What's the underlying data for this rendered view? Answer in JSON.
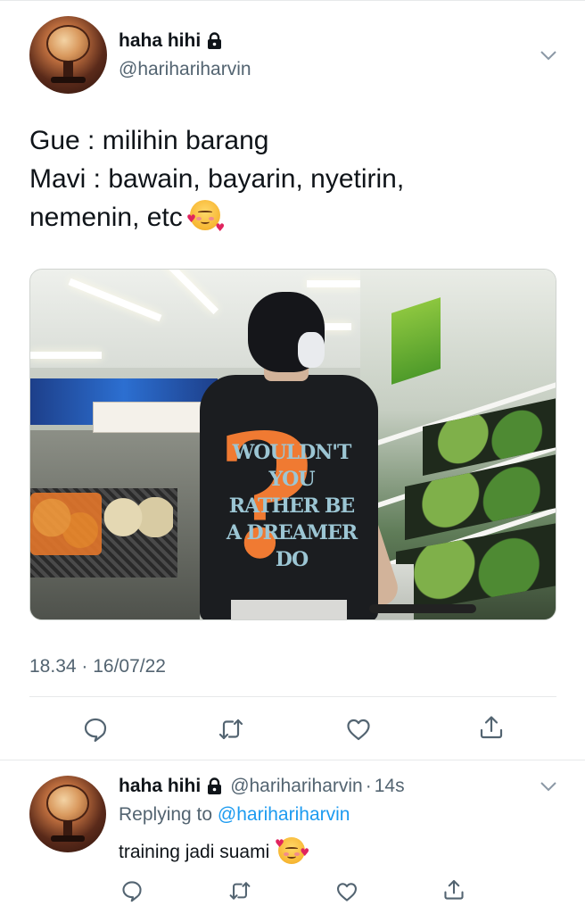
{
  "tweet": {
    "display_name": "haha hihi",
    "handle": "@harihariharvin",
    "lines": [
      "Gue : milihin barang",
      "Mavi : bawain, bayarin, nyetirin,",
      "nemenin, etc"
    ],
    "emoji": "smiling-face-with-hearts",
    "photo": {
      "shirt_print": [
        "WOULDN'T YOU",
        "RATHER BE",
        "A DREAMER",
        "DO"
      ]
    },
    "timestamp": "18.34 · 16/07/22",
    "actions": [
      "reply-icon",
      "retweet-icon",
      "like-icon",
      "share-icon"
    ]
  },
  "reply": {
    "display_name": "haha hihi",
    "handle": "@harihariharvin",
    "dot": "·",
    "time": "14s",
    "replying_prefix": "Replying to",
    "replying_to": "@harihariharvin",
    "text": "training jadi suami",
    "emoji": "smiling-face-with-hearts",
    "actions": [
      "reply-icon",
      "retweet-icon",
      "like-icon",
      "share-icon"
    ]
  },
  "colors": {
    "text": "#0f1419",
    "secondary": "#536471",
    "link": "#1d9bf0",
    "divider": "#e7e9ea"
  }
}
